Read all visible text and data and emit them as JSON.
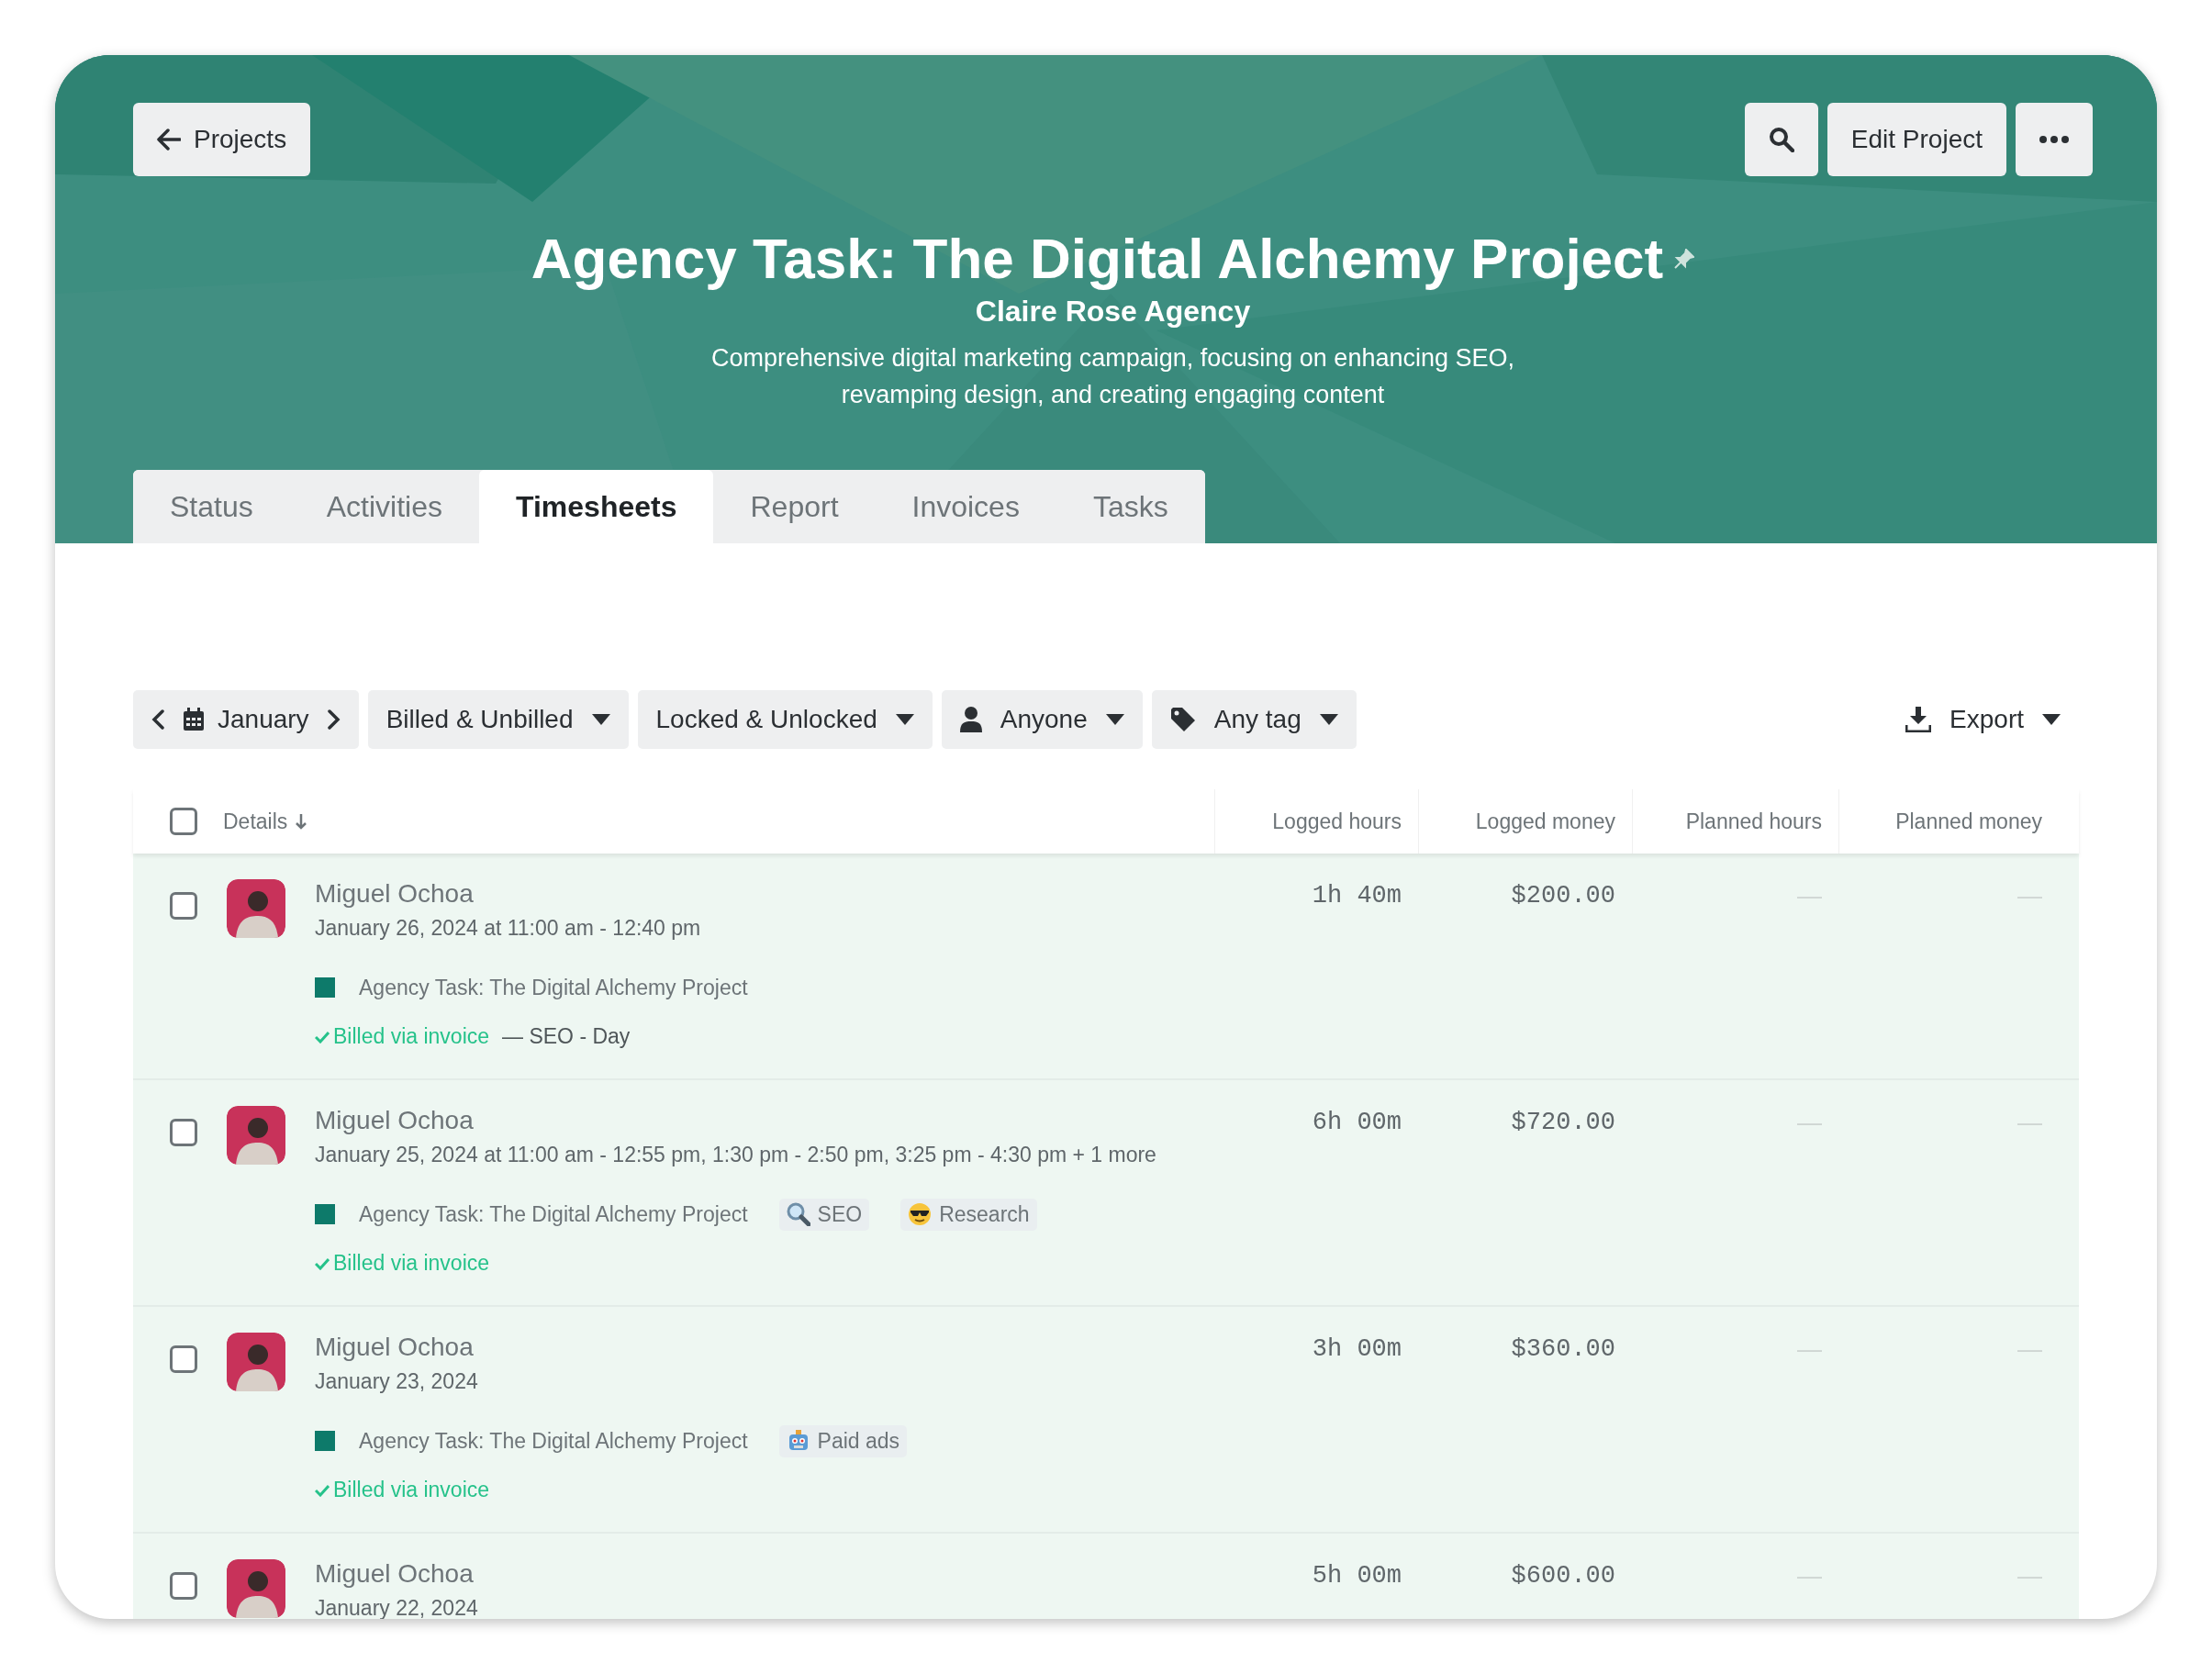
{
  "header": {
    "back_button": "Projects",
    "edit_button": "Edit Project",
    "title": "Agency Task: The Digital Alchemy Project",
    "client": "Claire Rose Agency",
    "description": "Comprehensive digital marketing campaign, focusing on enhancing SEO,\nrevamping design, and creating engaging content"
  },
  "tabs": [
    {
      "label": "Status",
      "selected": false
    },
    {
      "label": "Activities",
      "selected": false
    },
    {
      "label": "Timesheets",
      "selected": true
    },
    {
      "label": "Report",
      "selected": false
    },
    {
      "label": "Invoices",
      "selected": false
    },
    {
      "label": "Tasks",
      "selected": false
    }
  ],
  "filters": [
    {
      "kind": "date",
      "label": "January"
    },
    {
      "kind": "dropdown",
      "label": "Billed & Unbilled"
    },
    {
      "kind": "dropdown",
      "label": "Locked & Unlocked"
    },
    {
      "kind": "person",
      "label": "Anyone"
    },
    {
      "kind": "tag",
      "label": "Any tag"
    }
  ],
  "export_button": "Export",
  "table": {
    "select_all": {
      "checked": false
    },
    "columns": [
      {
        "label": "Details",
        "sorted": true
      },
      {
        "label": "Logged hours",
        "sorted": false
      },
      {
        "label": "Logged money",
        "sorted": false
      },
      {
        "label": "Planned hours",
        "sorted": false
      },
      {
        "label": "Planned money",
        "sorted": false
      }
    ],
    "rows": [
      {
        "checked": false,
        "name": "Miguel Ochoa",
        "date": "January 26, 2024 at 11:00 am - 12:40 pm",
        "project": "Agency Task: The Digital Alchemy Project",
        "tags": [],
        "billed": "Billed via invoice",
        "note": "— SEO - Day",
        "logged_hours": "1h 40m",
        "logged_money": "$200.00",
        "planned_hours": "—",
        "planned_money": "—"
      },
      {
        "checked": false,
        "name": "Miguel Ochoa",
        "date": "January 25, 2024 at 11:00 am - 12:55 pm, 1:30 pm - 2:50 pm, 3:25 pm - 4:30 pm + 1 more",
        "project": "Agency Task: The Digital Alchemy Project",
        "tags": [
          {
            "kind": "magnifier",
            "label": "SEO"
          },
          {
            "kind": "sunglasses",
            "label": "Research"
          }
        ],
        "billed": "Billed via invoice",
        "logged_hours": "6h 00m",
        "logged_money": "$720.00",
        "planned_hours": "—",
        "planned_money": "—"
      },
      {
        "checked": false,
        "name": "Miguel Ochoa",
        "date": "January 23, 2024",
        "project": "Agency Task: The Digital Alchemy Project",
        "tags": [
          {
            "kind": "robot",
            "label": "Paid ads"
          }
        ],
        "billed": "Billed via invoice",
        "logged_hours": "3h 00m",
        "logged_money": "$360.00",
        "planned_hours": "—",
        "planned_money": "—"
      },
      {
        "checked": false,
        "name": "Miguel Ochoa",
        "date": "January 22, 2024",
        "logged_hours": "5h 00m",
        "logged_money": "$600.00",
        "planned_hours": "—",
        "planned_money": "—"
      }
    ]
  }
}
